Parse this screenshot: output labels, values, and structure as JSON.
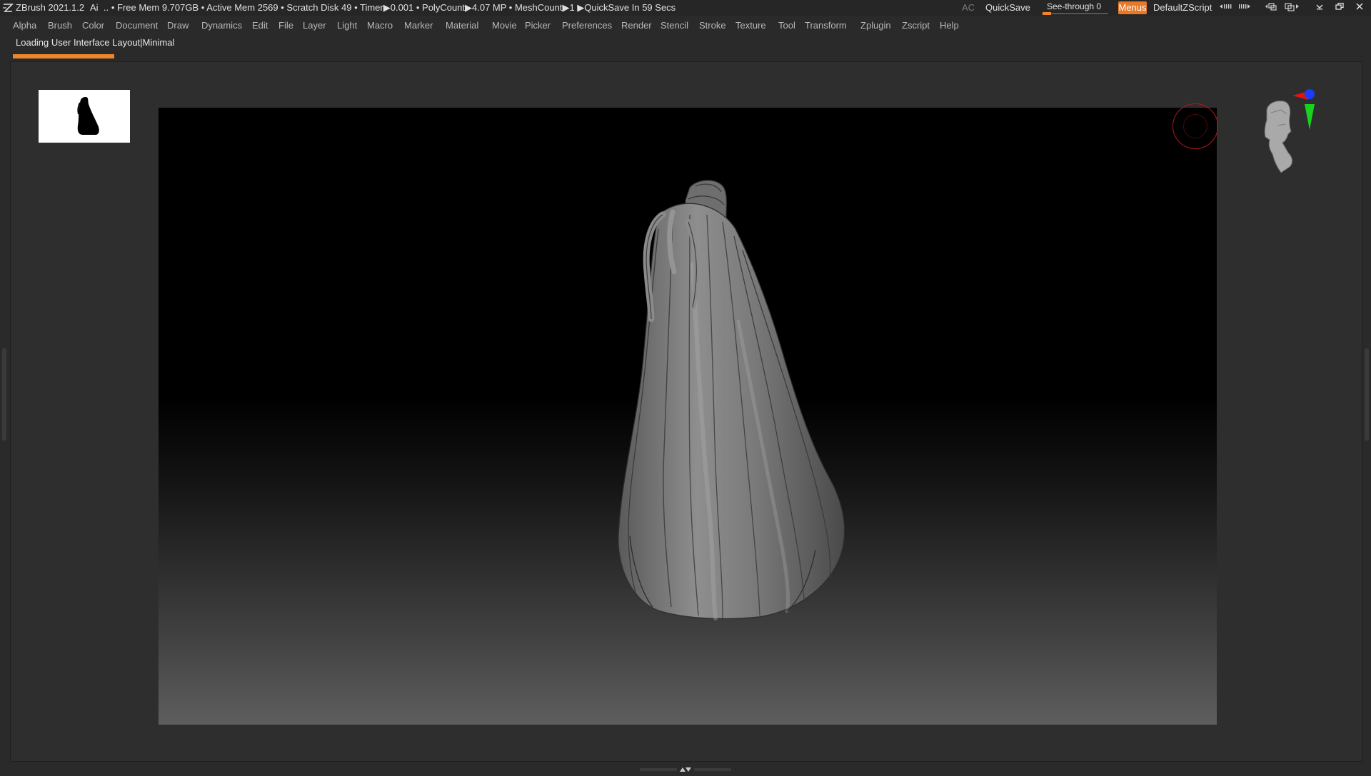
{
  "titlebar": {
    "app_title": "ZBrush 2021.1.2",
    "ai_label": "Ai",
    "status": ".. • Free Mem 9.707GB • Active Mem 2569 • Scratch Disk 49 •  Timer▶0.001 • PolyCount▶4.07 MP  • MeshCount▶1  ▶QuickSave In 59 Secs",
    "ac_label": "AC",
    "quicksave_label": "QuickSave",
    "seethrough_label": "See-through  0",
    "seethrough_value": 0,
    "menus_label": "Menus",
    "default_script_label": "DefaultZScript",
    "accent_color": "#e8782a"
  },
  "menubar": {
    "items": [
      "Alpha",
      "Brush",
      "Color",
      "Document",
      "Draw",
      "Dynamics",
      "Edit",
      "File",
      "Layer",
      "Light",
      "Macro",
      "Marker",
      "Material",
      "Movie",
      "Picker",
      "Preferences",
      "Render",
      "Stencil",
      "Stroke",
      "Texture",
      "Tool",
      "Transform",
      "Zplugin",
      "Zscript",
      "Help"
    ]
  },
  "notice": {
    "text": "Loading User Interface Layout|Minimal"
  },
  "icons": {
    "window_buttons": [
      "minimize-icon",
      "restore-icon",
      "close-icon"
    ],
    "layout_buttons": [
      "layout-left-icon",
      "layout-right-icon",
      "window-tile-icon",
      "window-cascade-icon"
    ]
  },
  "viewport": {
    "model": "long-hair-mesh",
    "background_top": "#000000",
    "background_bottom": "#5e5e5e"
  }
}
